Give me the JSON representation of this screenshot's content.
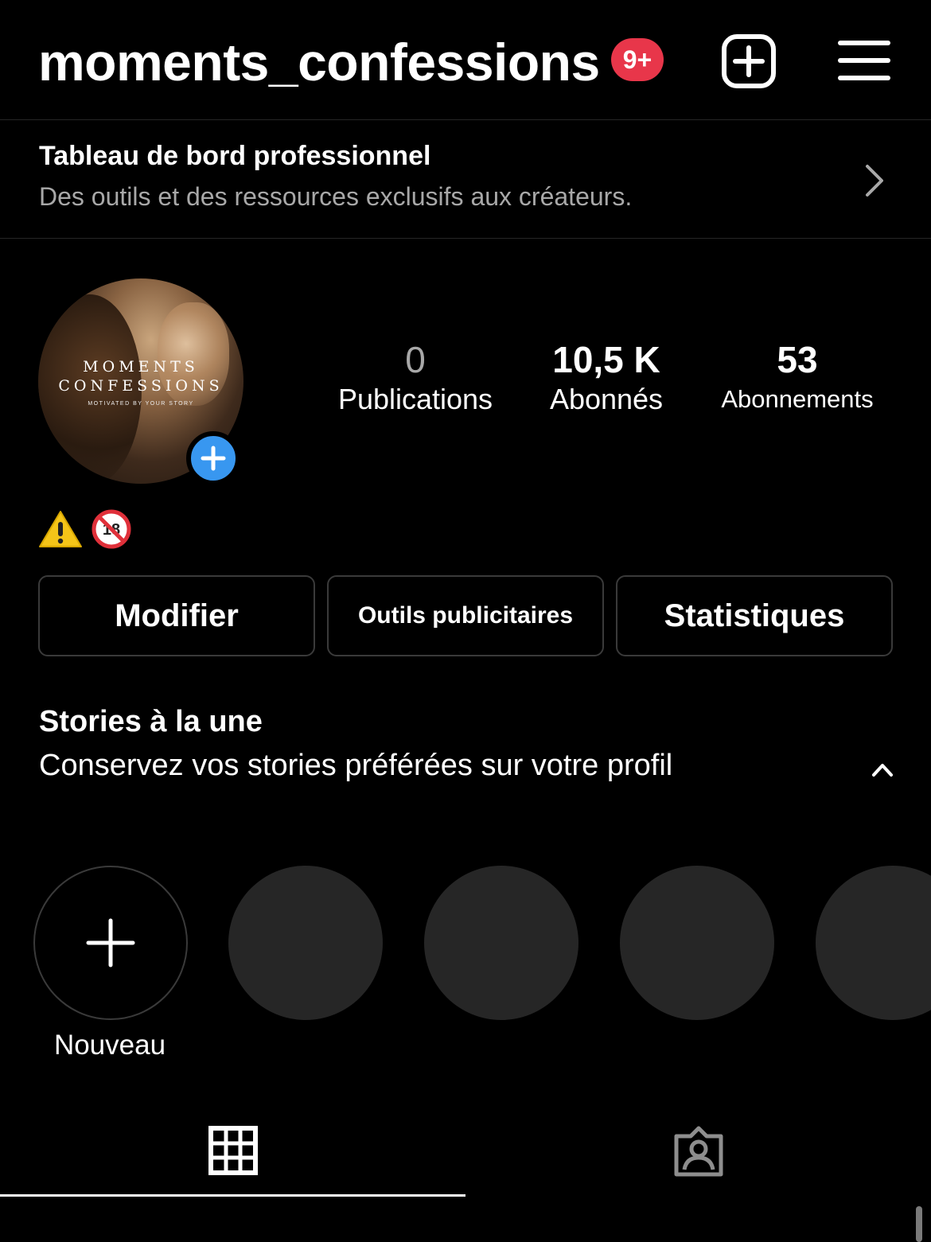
{
  "header": {
    "username": "moments_confessions",
    "notification_badge": "9+",
    "create_icon": "plus-square-icon",
    "menu_icon": "hamburger-menu-icon"
  },
  "dashboard": {
    "title": "Tableau de bord professionnel",
    "subtitle": "Des outils et des ressources exclusifs aux créateurs.",
    "icon": "chevron-right-icon"
  },
  "profile": {
    "avatar_text_line1": "MOMENTS",
    "avatar_text_line2": "CONFESSIONS",
    "avatar_text_line3": "MOTIVATED BY YOUR STORY",
    "stats": {
      "posts": {
        "value": "0",
        "label": "Publications"
      },
      "followers": {
        "value": "10,5 K",
        "label": "Abonnés"
      },
      "following": {
        "value": "53",
        "label": "Abonnements"
      }
    },
    "bio_emojis": [
      "warning-icon",
      "no-under-18-icon"
    ]
  },
  "actions": {
    "edit_label": "Modifier",
    "ads_label": "Outils publicitaires",
    "stats_label": "Statistiques"
  },
  "highlights": {
    "title": "Stories à la une",
    "subtitle": "Conservez vos stories préférées sur votre profil",
    "new_label": "Nouveau"
  },
  "tabs": [
    {
      "icon": "grid-icon",
      "active": true
    },
    {
      "icon": "tagged-person-icon",
      "active": false
    }
  ],
  "colors": {
    "background": "#000000",
    "badge": "#e8364a",
    "avatar_add": "#3897f0",
    "secondary_text": "#a8a8a8",
    "placeholder": "#262626"
  }
}
